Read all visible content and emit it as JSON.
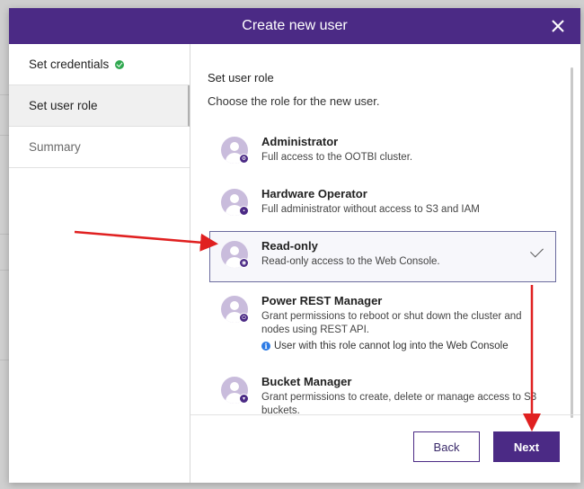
{
  "dialog": {
    "title": "Create new user",
    "close_icon": "close-icon"
  },
  "steps": [
    {
      "label": "Set credentials",
      "state": "done"
    },
    {
      "label": "Set user role",
      "state": "active"
    },
    {
      "label": "Summary",
      "state": "pending"
    }
  ],
  "main": {
    "section_title": "Set user role",
    "section_subtitle": "Choose the role for the new user."
  },
  "roles": [
    {
      "name": "Administrator",
      "description": "Full access to the OOTBI cluster.",
      "badge_icon": "gear-icon"
    },
    {
      "name": "Hardware Operator",
      "description": "Full administrator without access to S3 and IAM",
      "badge_icon": "server-icon"
    },
    {
      "name": "Read-only",
      "description": "Read-only access to the Web Console.",
      "badge_icon": "eye-icon",
      "selected": true
    },
    {
      "name": "Power REST Manager",
      "description": "Grant permissions to reboot or shut down the cluster and nodes using REST API.",
      "note": "User with this role cannot log into the Web Console",
      "badge_icon": "power-icon"
    },
    {
      "name": "Bucket Manager",
      "description": "Grant permissions to create, delete or manage access to S3 buckets.",
      "badge_icon": "bucket-icon"
    }
  ],
  "footer": {
    "back_label": "Back",
    "next_label": "Next"
  },
  "colors": {
    "brand": "#4b2a85",
    "success": "#2fa84f",
    "info": "#2c7be5",
    "annotation": "#e02020"
  }
}
